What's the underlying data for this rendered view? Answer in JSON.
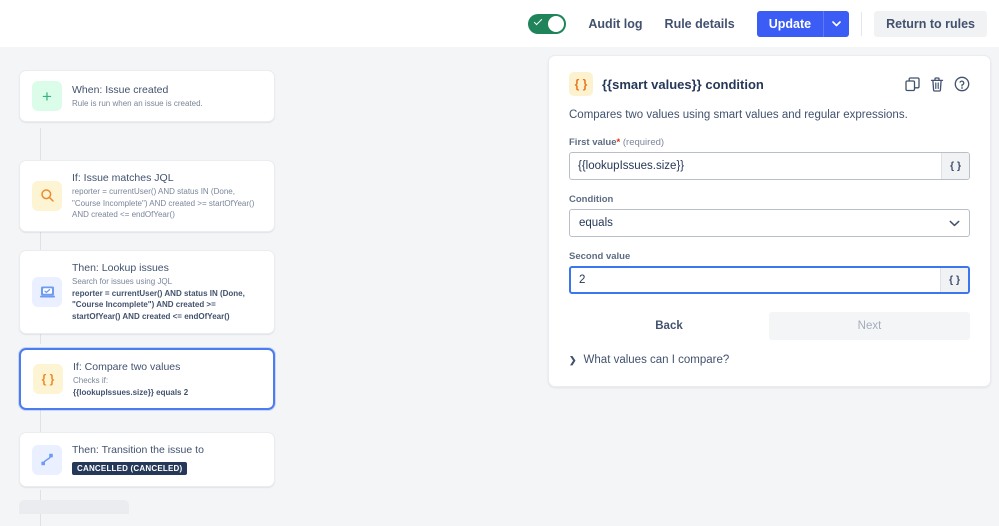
{
  "topbar": {
    "toggle_state": "on",
    "toggle_name": "rule-enabled-toggle",
    "audit_log": "Audit log",
    "rule_details": "Rule details",
    "update": "Update",
    "update_caret": "⌄",
    "return_to_rules": "Return to rules"
  },
  "rule_chain": [
    {
      "icon": "plus-icon",
      "icon_glyph": "+",
      "icon_style": "green",
      "title": "When: Issue created",
      "sub": "Rule is run when an issue is created.",
      "selected": false
    },
    {
      "icon": "magnifier-icon",
      "icon_glyph": "🔍",
      "icon_style": "yellow",
      "title": "If: Issue matches JQL",
      "sub": "reporter = currentUser() AND status IN (Done, \"Course Incomplete\") AND created >= startOfYear() AND created <= endOfYear()",
      "selected": false
    },
    {
      "icon": "lookup-screen-icon",
      "icon_glyph": "",
      "icon_style": "blue",
      "title": "Then: Lookup issues",
      "sub": "Search for issues using JQL",
      "sub_bold": "reporter = currentUser() AND status IN (Done, \"Course Incomplete\") AND created >= startOfYear() AND created <= endOfYear()",
      "selected": false
    },
    {
      "icon": "braces-icon",
      "icon_glyph": "{ }",
      "icon_style": "yellow",
      "title": "If: Compare two values",
      "sub": "Checks if:",
      "sub_bold": "{{lookupIssues.size}} equals 2",
      "selected": true
    },
    {
      "icon": "transition-path-icon",
      "icon_glyph": "",
      "icon_style": "blue",
      "title": "Then: Transition the issue to",
      "badge": "CANCELLED (CANCELED)",
      "selected": false
    }
  ],
  "panel": {
    "icon": "braces-icon",
    "icon_glyph": "{ }",
    "title": "{{smart values}} condition",
    "description": "Compares two values using smart values and regular expressions.",
    "head_icons": [
      "copy-icon",
      "trash-icon",
      "help-icon"
    ],
    "first_value": {
      "label": "First value",
      "required_marker": "*",
      "required_note": "(required)",
      "value": "{{lookupIssues.size}}",
      "brace_button": "{ }"
    },
    "condition": {
      "label": "Condition",
      "value": "equals"
    },
    "second_value": {
      "label": "Second value",
      "value": "2",
      "brace_button": "{ }",
      "focused": true
    },
    "back": "Back",
    "next": "Next",
    "expander_arrow": "❯",
    "expander_text": "What values can I compare?"
  },
  "colors": {
    "background": "#f4f5f7",
    "accent_blue": "#3b5cf5",
    "toggle_green": "#1f845a",
    "badge_navy": "#253858",
    "icon_orange": "#e8761f",
    "selected_border": "#4c7df0"
  }
}
